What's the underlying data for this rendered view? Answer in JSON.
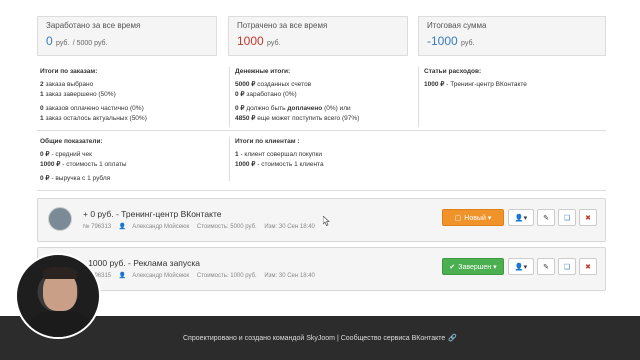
{
  "stats": [
    {
      "label": "Заработано за все время",
      "value": "0",
      "unit": "руб.",
      "sub": "/ 5000 руб."
    },
    {
      "label": "Потрачено за все время",
      "value": "1000",
      "unit": "руб."
    },
    {
      "label": "Итоговая сумма",
      "value": "-1000",
      "unit": "руб."
    }
  ],
  "orders": {
    "heading": "Итоги по заказам:",
    "l1n": "2",
    "l1t": "заказа выбрано",
    "l2n": "1",
    "l2t": "заказ завершено (50%)",
    "l3n": "0",
    "l3t": "заказов оплачено частично (0%)",
    "l4n": "1",
    "l4t": "заказ осталось актуальных (50%)"
  },
  "money": {
    "heading": "Денежные итоги:",
    "l1n": "5000 ₽",
    "l1t": "созданных счетов",
    "l2n": "0 ₽",
    "l2t": "заработано (0%)",
    "l3n": "0 ₽",
    "l3t": "должно быть",
    "l3b": "доплачено",
    "l3e": "(0%) или",
    "l4n": "4850 ₽",
    "l4t": "еще может поступить всего (97%)"
  },
  "expenses": {
    "heading": "Статьи расходов:",
    "l1n": "1000 ₽",
    "l1t": "- Тренинг-центр ВКонтакте"
  },
  "general": {
    "heading": "Общие показатели:",
    "l1n": "0 ₽",
    "l1t": "- средний чек",
    "l2n": "1000 ₽",
    "l2t": "- стоимость 1 оплаты",
    "l3n": "0 ₽",
    "l3t": "- выручка с 1 рубля"
  },
  "clients": {
    "heading": "Итоги по клиентам :",
    "l1n": "1",
    "l1t": "- клиент совершал покупки",
    "l2n": "1000 ₽",
    "l2t": "- стоимость 1 клиента"
  },
  "cards": [
    {
      "title": "+ 0 руб. - Тренинг-центр ВКонтакте",
      "num": "№ 796313",
      "author": "Александр Мойсеюк",
      "cost": "Стоимость: 5000 руб.",
      "changed": "Изм: 30 Сен 18:40",
      "status": "Новый ▾"
    },
    {
      "title": "- 1000 руб. - Реклама запуска",
      "num": "№ 796315",
      "author": "Александр Мойсеюк",
      "cost": "Стоимость: 1000 руб.",
      "changed": "Изм: 30 Сен 18:40",
      "status": "Завершен ▾"
    }
  ],
  "footer": {
    "text": "Спроектировано и создано командой SkyJoom | Сообщество сервиса ВКонтакте"
  },
  "colors": {
    "positive": "#3a7bbf",
    "negative": "#c0392b",
    "status_new": "#f0932b",
    "status_done": "#4caf50"
  }
}
